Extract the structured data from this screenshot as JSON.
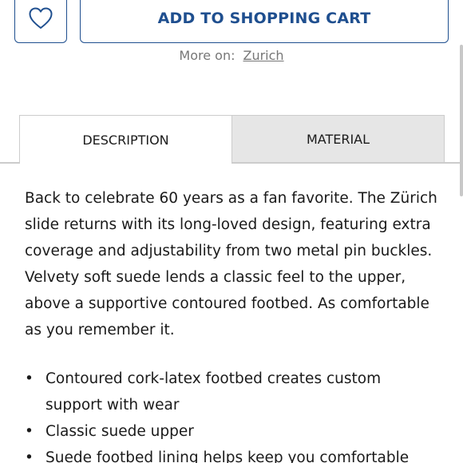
{
  "actions": {
    "wishlist_icon": "heart-icon",
    "add_to_cart_label": "ADD TO SHOPPING CART"
  },
  "more_on": {
    "label": "More on:",
    "link": "Zurich"
  },
  "tabs": [
    {
      "label": "DESCRIPTION",
      "active": true
    },
    {
      "label": "MATERIAL",
      "active": false
    }
  ],
  "description": "Back to celebrate 60 years as a fan favorite. The Zürich slide returns with its long-loved design, featuring extra coverage and adjustability from two metal pin buckles. Velvety soft suede lends a classic feel to the upper, above a supportive contoured footbed. As comfortable as you remember it.",
  "features": [
    "Contoured cork-latex footbed creates custom support with wear",
    "Classic suede upper",
    "Suede footbed lining helps keep you comfortable"
  ],
  "colors": {
    "brand_blue": "#1f4f8f",
    "inactive_tab": "#e6e6e6",
    "muted_text": "#777777"
  }
}
